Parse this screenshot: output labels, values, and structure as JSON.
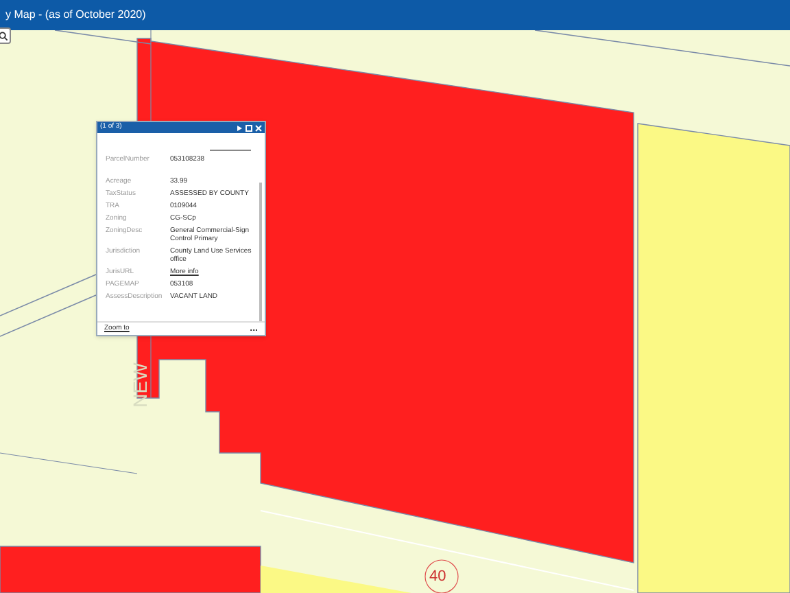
{
  "window": {
    "title": "y Map - (as of October 2020)"
  },
  "popup": {
    "counter": "(1 of 3)",
    "fields": [
      {
        "label": "ParcelNumber",
        "value": "053108238",
        "kind": "text"
      },
      {
        "label": "Acreage",
        "value": "33.99",
        "kind": "text"
      },
      {
        "label": "TaxStatus",
        "value": "ASSESSED BY COUNTY",
        "kind": "text"
      },
      {
        "label": "TRA",
        "value": "0109044",
        "kind": "text"
      },
      {
        "label": "Zoning",
        "value": "CG-SCp",
        "kind": "text"
      },
      {
        "label": "ZoningDesc",
        "value": "General Commercial-Sign Control Primary",
        "kind": "text"
      },
      {
        "label": "Jurisdiction",
        "value": "County Land Use Services office",
        "kind": "text"
      },
      {
        "label": "JurisURL",
        "value": "More info",
        "kind": "link"
      },
      {
        "label": "PAGEMAP",
        "value": "053108",
        "kind": "text"
      },
      {
        "label": "AssessDescription",
        "value": "VACANT LAND",
        "kind": "text"
      }
    ],
    "footer_link": "Zoom to",
    "more": "..."
  },
  "map_labels": {
    "street": "NEW",
    "route": "40"
  }
}
